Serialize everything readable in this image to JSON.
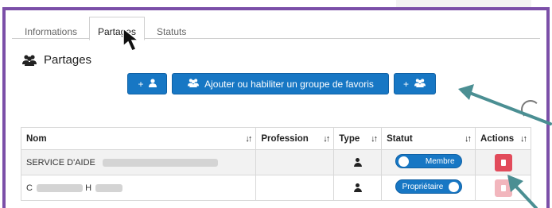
{
  "tabs": [
    {
      "label": "Informations"
    },
    {
      "label": "Partages"
    },
    {
      "label": "Statuts"
    }
  ],
  "section": {
    "title": "Partages",
    "icon": "users-icon"
  },
  "buttons": {
    "add_user": {
      "label": "+",
      "icon": "user-icon"
    },
    "add_group": {
      "label": "Ajouter ou habiliter un groupe de favoris",
      "icon": "users-icon"
    },
    "add_group_small": {
      "label": "+",
      "icon": "users-icon"
    }
  },
  "table": {
    "columns": [
      "Nom",
      "Profession",
      "Type",
      "Statut",
      "Actions"
    ],
    "sort_glyph": "↓↑",
    "rows": [
      {
        "nom": "SERVICE D'AIDE",
        "profession": "",
        "type_icon": "person-icon",
        "statut": "Membre",
        "action_icon": "trash-icon"
      },
      {
        "nom_initial": "C",
        "nom_second": "H",
        "profession": "",
        "type_icon": "person-icon",
        "statut": "Propriétaire",
        "action_icon": "trash-icon"
      }
    ]
  },
  "colors": {
    "accent": "#1777c4",
    "frame": "#7b4fa8",
    "annotation_arrow": "#4b8f93",
    "danger": "#e24b5b"
  }
}
